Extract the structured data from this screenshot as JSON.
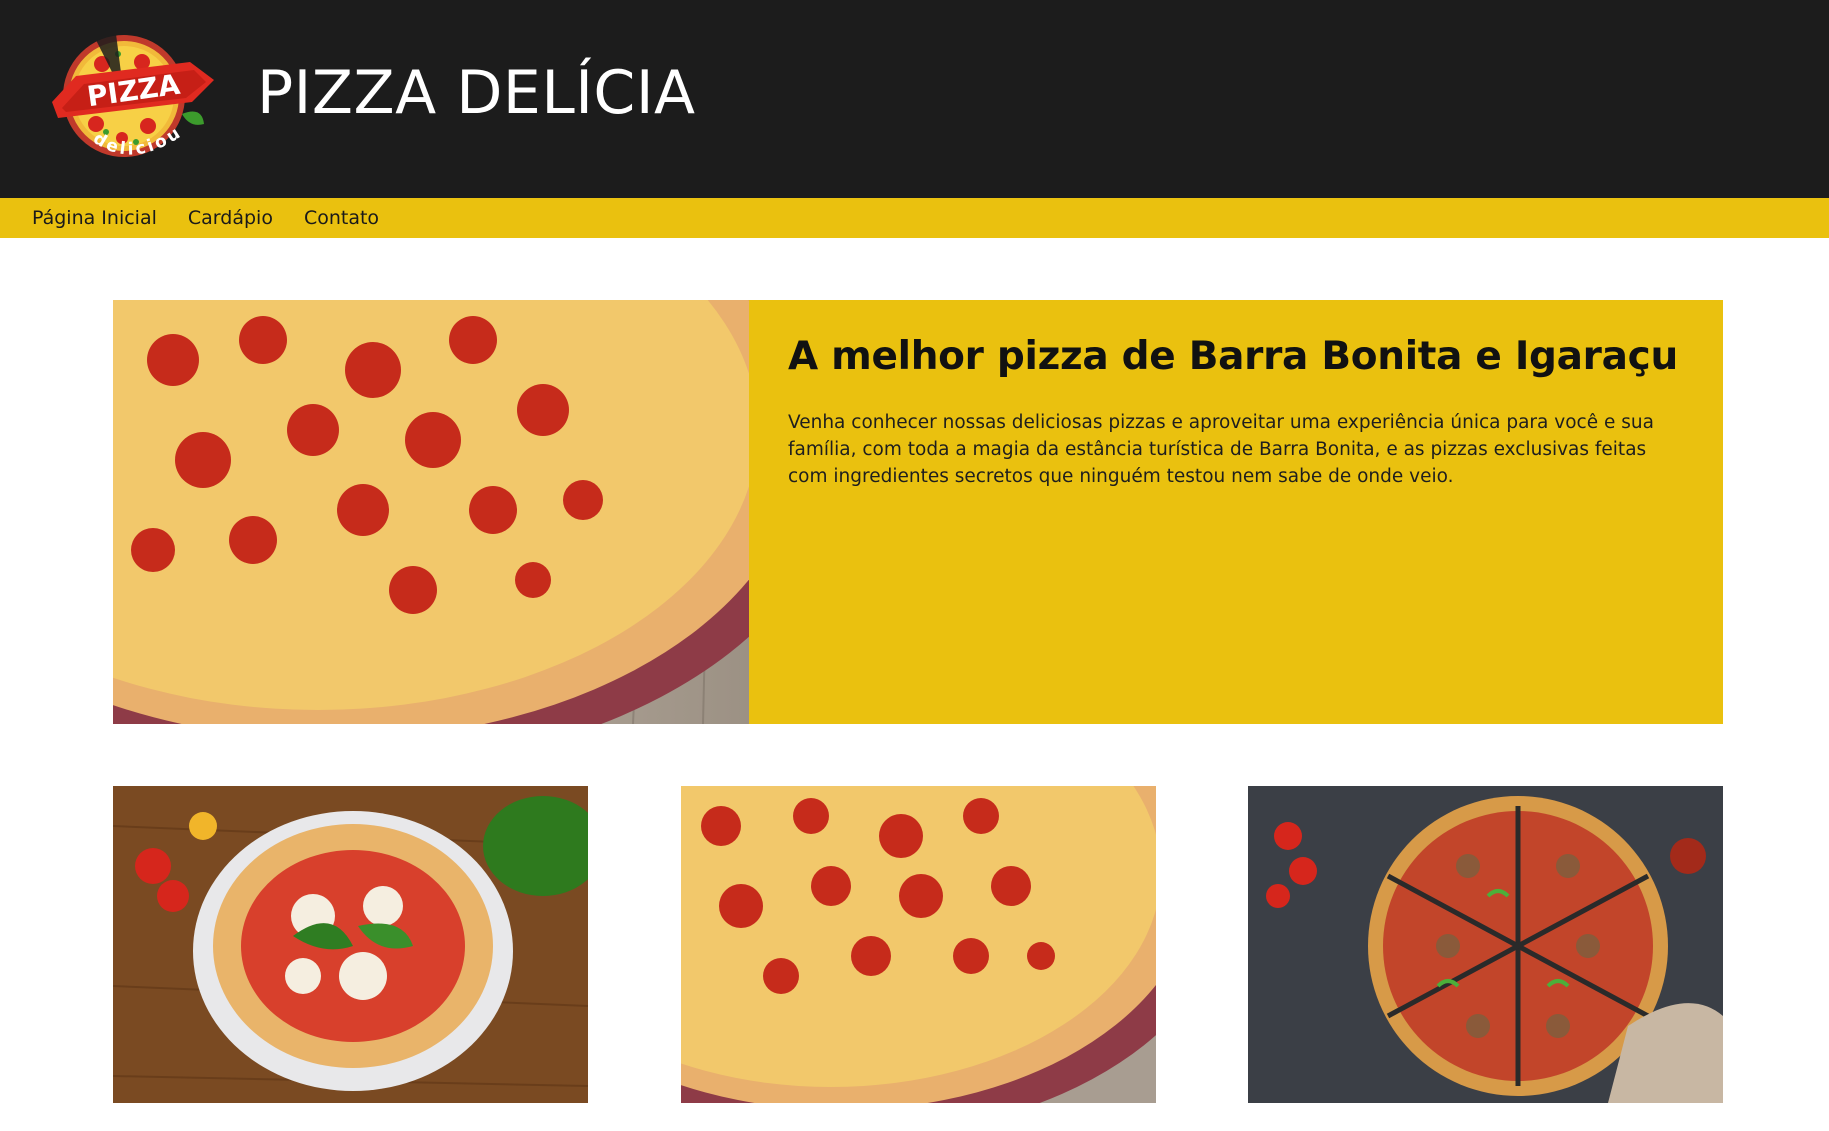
{
  "header": {
    "logo": {
      "icon": "pizza-delicious-logo",
      "word": "PIZZA",
      "tagline": "delicious"
    },
    "site_title": "PIZZA DELÍCIA"
  },
  "nav": {
    "items": [
      {
        "label": "Página Inicial"
      },
      {
        "label": "Cardápio"
      },
      {
        "label": "Contato"
      }
    ]
  },
  "hero": {
    "image": "pepperoni-pizza-photo",
    "title": "A melhor pizza de Barra Bonita e Igaraçu",
    "text": "Venha conhecer nossas deliciosas pizzas e aproveitar uma experiência única para você e sua família, com toda a magia da estância turística de Barra Bonita, e as pizzas exclusivas feitas com ingredientes secretos que ninguém testou nem sabe de onde veio."
  },
  "gallery": {
    "images": [
      {
        "name": "margherita-pizza-photo"
      },
      {
        "name": "pepperoni-pizza-photo"
      },
      {
        "name": "sliced-pizza-photo"
      }
    ]
  },
  "colors": {
    "header_bg": "#1c1c1c",
    "accent_yellow": "#eac10f",
    "page_bg": "#ffffff"
  }
}
